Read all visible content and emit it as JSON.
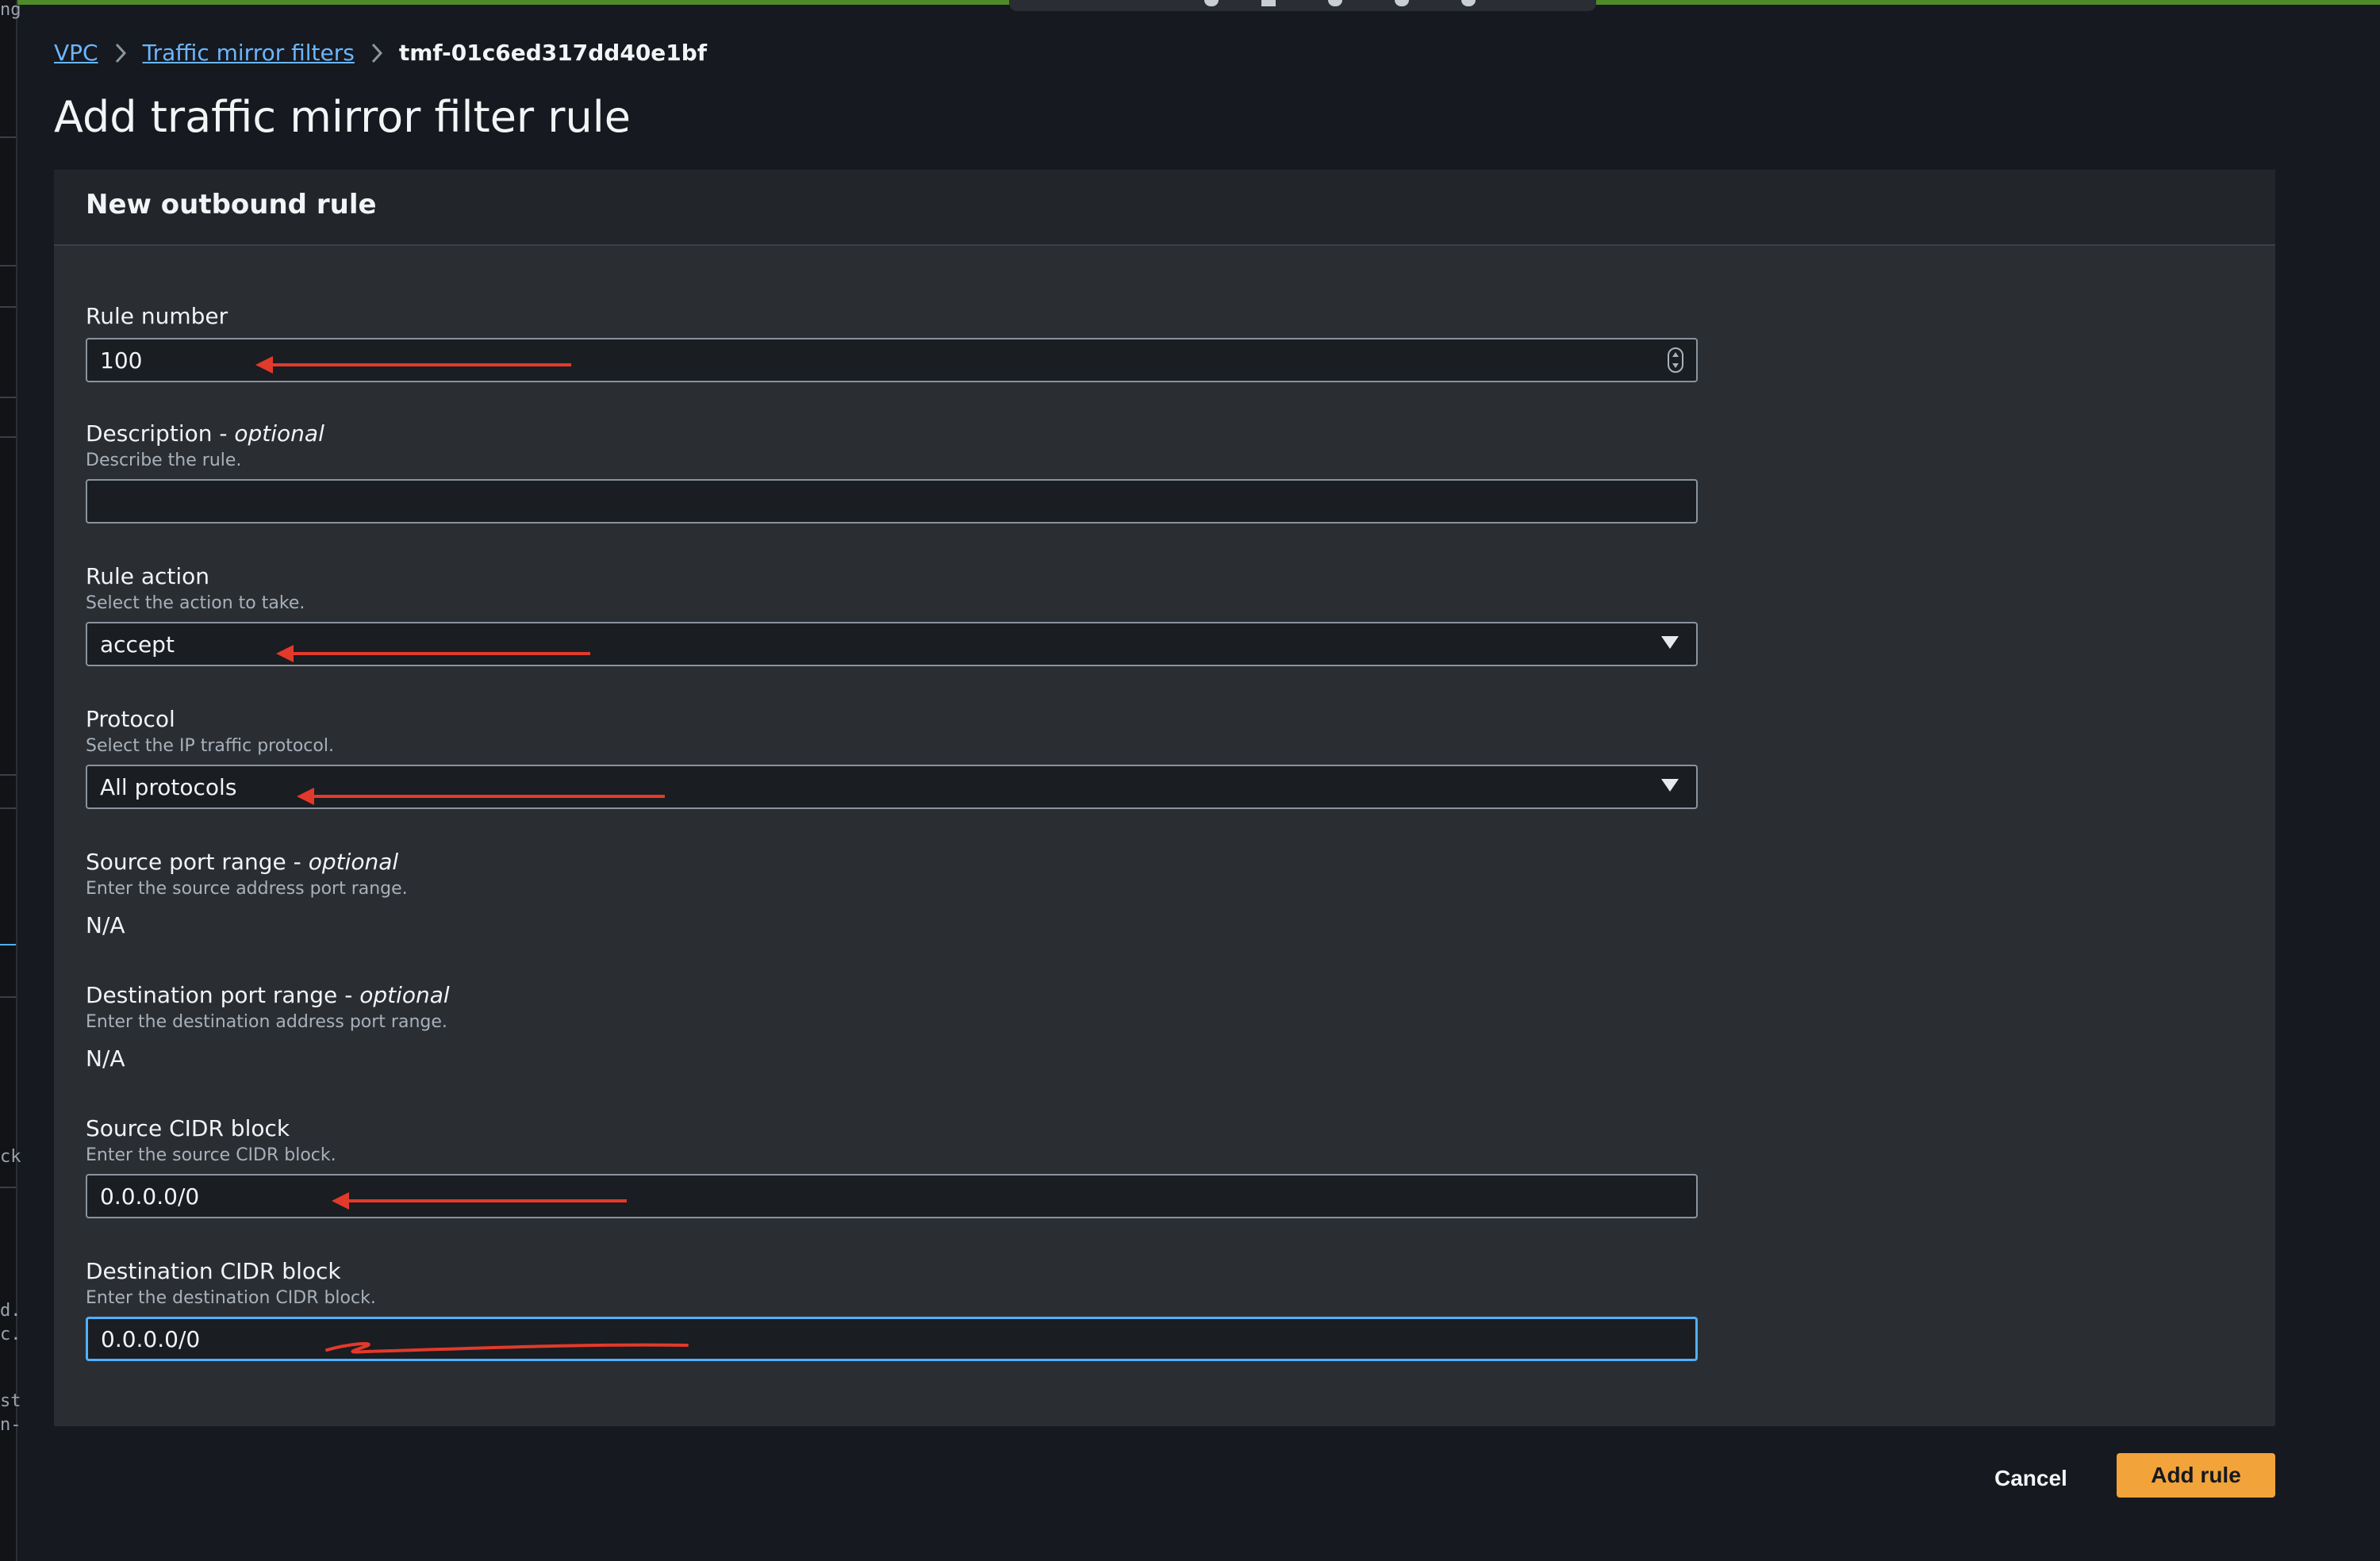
{
  "breadcrumb": {
    "items": [
      "VPC",
      "Traffic mirror filters"
    ],
    "current": "tmf-01c6ed317dd40e1bf"
  },
  "page": {
    "title": "Add traffic mirror filter rule"
  },
  "panel": {
    "title": "New outbound rule"
  },
  "fields": {
    "rule_number": {
      "label": "Rule number",
      "value": "100"
    },
    "description": {
      "label": "Description",
      "optional": "optional",
      "hint": "Describe the rule.",
      "value": ""
    },
    "rule_action": {
      "label": "Rule action",
      "hint": "Select the action to take.",
      "value": "accept"
    },
    "protocol": {
      "label": "Protocol",
      "hint": "Select the IP traffic protocol.",
      "value": "All protocols"
    },
    "source_port_range": {
      "label": "Source port range",
      "optional": "optional",
      "hint": "Enter the source address port range.",
      "value": "N/A"
    },
    "destination_port_range": {
      "label": "Destination port range",
      "optional": "optional",
      "hint": "Enter the destination address port range.",
      "value": "N/A"
    },
    "source_cidr": {
      "label": "Source CIDR block",
      "hint": "Enter the source CIDR block.",
      "value": "0.0.0.0/0"
    },
    "destination_cidr": {
      "label": "Destination CIDR block",
      "hint": "Enter the destination CIDR block.",
      "value": "0.0.0.0/0"
    }
  },
  "actions": {
    "cancel": "Cancel",
    "submit": "Add rule"
  },
  "left_strip_fragments": [
    "ng",
    "ck",
    "d.",
    "c.",
    "st",
    "n-"
  ],
  "colors": {
    "accent": "#f2a33a",
    "link": "#6cb5ff",
    "annotation": "#e23a2a",
    "focus": "#4fb0ff"
  }
}
